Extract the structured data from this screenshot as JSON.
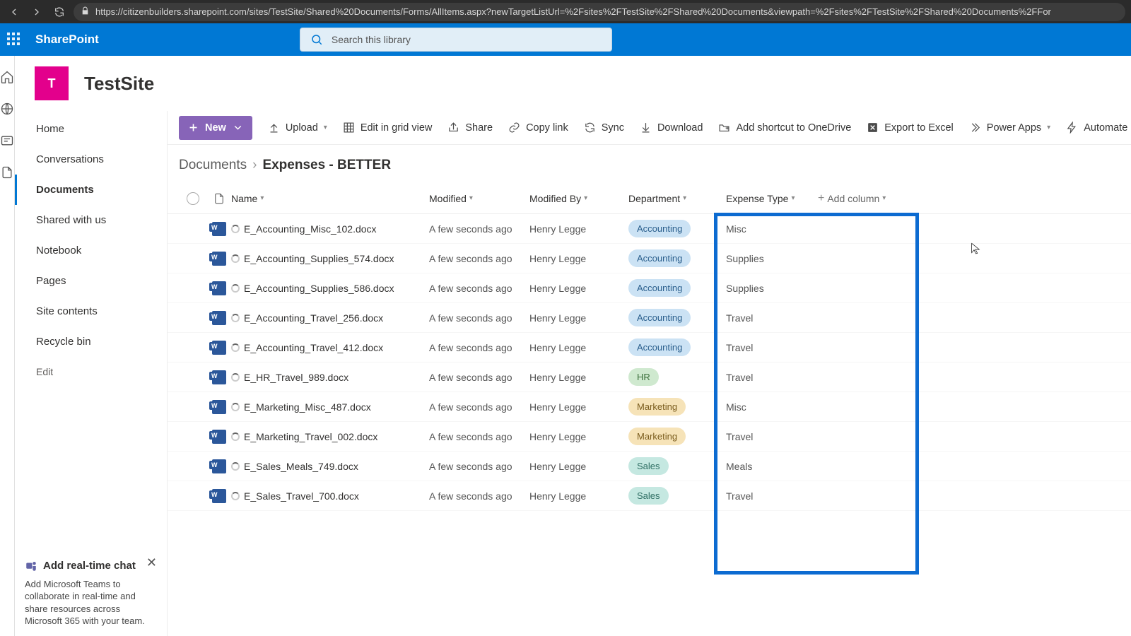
{
  "browser": {
    "url": "https://citizenbuilders.sharepoint.com/sites/TestSite/Shared%20Documents/Forms/AllItems.aspx?newTargetListUrl=%2Fsites%2FTestSite%2FShared%20Documents&viewpath=%2Fsites%2FTestSite%2FShared%20Documents%2FFor"
  },
  "suite": {
    "app": "SharePoint"
  },
  "search": {
    "placeholder": "Search this library"
  },
  "site": {
    "logo_letter": "T",
    "title": "TestSite"
  },
  "nav": {
    "items": [
      "Home",
      "Conversations",
      "Documents",
      "Shared with us",
      "Notebook",
      "Pages",
      "Site contents",
      "Recycle bin"
    ],
    "selected": "Documents",
    "edit": "Edit"
  },
  "promo": {
    "title": "Add real-time chat",
    "desc": "Add Microsoft Teams to collaborate in real-time and share resources across Microsoft 365 with your team."
  },
  "commands": {
    "new": "New",
    "upload": "Upload",
    "editGrid": "Edit in grid view",
    "share": "Share",
    "copy": "Copy link",
    "sync": "Sync",
    "download": "Download",
    "shortcut": "Add shortcut to OneDrive",
    "export": "Export to Excel",
    "powerApps": "Power Apps",
    "automate": "Automate"
  },
  "breadcrumb": {
    "root": "Documents",
    "current": "Expenses - BETTER"
  },
  "columns": {
    "name": "Name",
    "modified": "Modified",
    "by": "Modified By",
    "dept": "Department",
    "type": "Expense Type",
    "add": "Add column"
  },
  "rows": [
    {
      "name": "E_Accounting_Misc_102.docx",
      "modified": "A few seconds ago",
      "by": "Henry Legge",
      "dept": "Accounting",
      "type": "Misc"
    },
    {
      "name": "E_Accounting_Supplies_574.docx",
      "modified": "A few seconds ago",
      "by": "Henry Legge",
      "dept": "Accounting",
      "type": "Supplies"
    },
    {
      "name": "E_Accounting_Supplies_586.docx",
      "modified": "A few seconds ago",
      "by": "Henry Legge",
      "dept": "Accounting",
      "type": "Supplies"
    },
    {
      "name": "E_Accounting_Travel_256.docx",
      "modified": "A few seconds ago",
      "by": "Henry Legge",
      "dept": "Accounting",
      "type": "Travel"
    },
    {
      "name": "E_Accounting_Travel_412.docx",
      "modified": "A few seconds ago",
      "by": "Henry Legge",
      "dept": "Accounting",
      "type": "Travel"
    },
    {
      "name": "E_HR_Travel_989.docx",
      "modified": "A few seconds ago",
      "by": "Henry Legge",
      "dept": "HR",
      "type": "Travel"
    },
    {
      "name": "E_Marketing_Misc_487.docx",
      "modified": "A few seconds ago",
      "by": "Henry Legge",
      "dept": "Marketing",
      "type": "Misc"
    },
    {
      "name": "E_Marketing_Travel_002.docx",
      "modified": "A few seconds ago",
      "by": "Henry Legge",
      "dept": "Marketing",
      "type": "Travel"
    },
    {
      "name": "E_Sales_Meals_749.docx",
      "modified": "A few seconds ago",
      "by": "Henry Legge",
      "dept": "Sales",
      "type": "Meals"
    },
    {
      "name": "E_Sales_Travel_700.docx",
      "modified": "A few seconds ago",
      "by": "Henry Legge",
      "dept": "Sales",
      "type": "Travel"
    }
  ],
  "deptClass": {
    "Accounting": "pill-accounting",
    "HR": "pill-hr",
    "Marketing": "pill-marketing",
    "Sales": "pill-sales"
  }
}
